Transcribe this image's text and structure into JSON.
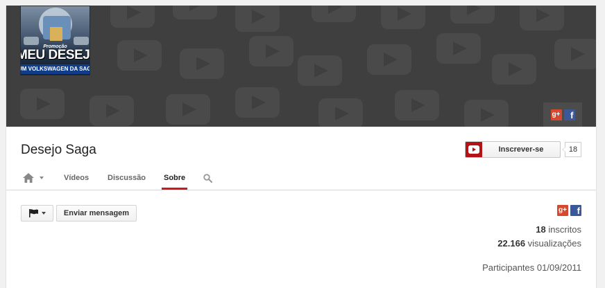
{
  "channel": {
    "name": "Desejo Saga",
    "avatar_text": {
      "top": "Promoção",
      "middle": "MEU DESEJO",
      "bottom": "UM VOLKSWAGEN DA SAGA"
    }
  },
  "subscribe": {
    "label": "Inscrever-se",
    "count": "18"
  },
  "tabs": [
    {
      "label": "Vídeos",
      "active": false
    },
    {
      "label": "Discussão",
      "active": false
    },
    {
      "label": "Sobre",
      "active": true
    }
  ],
  "actions": {
    "message_label": "Enviar mensagem"
  },
  "social": {
    "gplus_label": "g+",
    "facebook_label": "f"
  },
  "stats": {
    "subscribers_value": "18",
    "subscribers_label": "inscritos",
    "views_value": "22.166",
    "views_label": "visualizações",
    "joined": "Participantes 01/09/2011"
  },
  "colors": {
    "banner_bg": "#3f3f3f",
    "accent_red": "#cc181e",
    "subscribe_red": "#b31217",
    "facebook": "#3b5998",
    "gplus": "#d6492f"
  }
}
